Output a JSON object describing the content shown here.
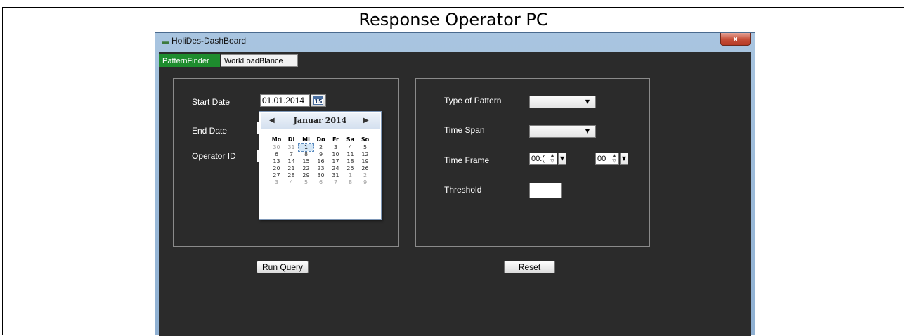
{
  "slide": {
    "title": "Response Operator PC"
  },
  "window": {
    "title": "HoliDes-DashBoard",
    "close_label": "x"
  },
  "tabs": [
    {
      "label": "PatternFinder",
      "active": true
    },
    {
      "label": "WorkLoadBlance",
      "active": false
    }
  ],
  "left_panel": {
    "start_date_label": "Start Date",
    "start_date_value": "01.01.2014",
    "calendar_button_day": "15",
    "end_date_label": "End Date",
    "operator_id_label": "Operator ID"
  },
  "calendar": {
    "month": "Januar 2014",
    "prev": "◀",
    "next": "▶",
    "weekdays": [
      "Mo",
      "Di",
      "Mi",
      "Do",
      "Fr",
      "Sa",
      "So"
    ],
    "weeks": [
      [
        "30",
        "31",
        "1",
        "2",
        "3",
        "4",
        "5"
      ],
      [
        "6",
        "7",
        "8",
        "9",
        "10",
        "11",
        "12"
      ],
      [
        "13",
        "14",
        "15",
        "16",
        "17",
        "18",
        "19"
      ],
      [
        "20",
        "21",
        "22",
        "23",
        "24",
        "25",
        "26"
      ],
      [
        "27",
        "28",
        "29",
        "30",
        "31",
        "1",
        "2"
      ],
      [
        "3",
        "4",
        "5",
        "6",
        "7",
        "8",
        "9"
      ]
    ],
    "selected": "1"
  },
  "right_panel": {
    "type_of_pattern_label": "Type of Pattern",
    "time_span_label": "Time Span",
    "time_frame_label": "Time Frame",
    "time_frame_from": "00:(",
    "time_frame_to": "00",
    "threshold_label": "Threshold"
  },
  "buttons": {
    "run_query": "Run Query",
    "reset": "Reset"
  },
  "colors": {
    "client_bg": "#2b2b2b",
    "tab_active": "#1e8c2e",
    "close": "#c7513b"
  }
}
